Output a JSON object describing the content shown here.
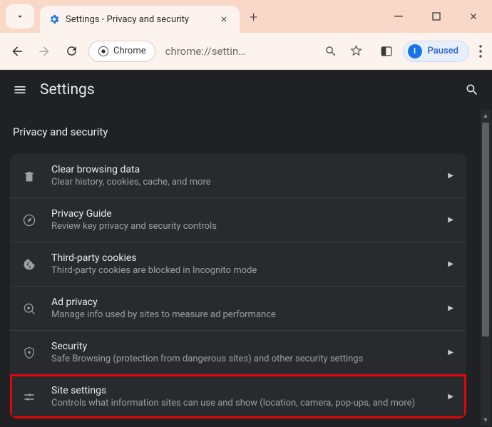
{
  "window": {
    "tab_title": "Settings - Privacy and security",
    "profile_state": "Paused",
    "profile_initial": "I"
  },
  "toolbar": {
    "chrome_chip": "Chrome",
    "url_display": "chrome://settin…"
  },
  "appbar": {
    "title": "Settings"
  },
  "section": {
    "heading": "Privacy and security"
  },
  "rows": [
    {
      "icon": "trash-icon",
      "title": "Clear browsing data",
      "sub": "Clear history, cookies, cache, and more",
      "highlight": false
    },
    {
      "icon": "compass-icon",
      "title": "Privacy Guide",
      "sub": "Review key privacy and security controls",
      "highlight": false
    },
    {
      "icon": "cookie-icon",
      "title": "Third-party cookies",
      "sub": "Third-party cookies are blocked in Incognito mode",
      "highlight": false
    },
    {
      "icon": "ad-icon",
      "title": "Ad privacy",
      "sub": "Manage info used by sites to measure ad performance",
      "highlight": false
    },
    {
      "icon": "shield-icon",
      "title": "Security",
      "sub": "Safe Browsing (protection from dangerous sites) and other security settings",
      "highlight": false
    },
    {
      "icon": "sliders-icon",
      "title": "Site settings",
      "sub": "Controls what information sites can use and show (location, camera, pop-ups, and more)",
      "highlight": true
    }
  ]
}
